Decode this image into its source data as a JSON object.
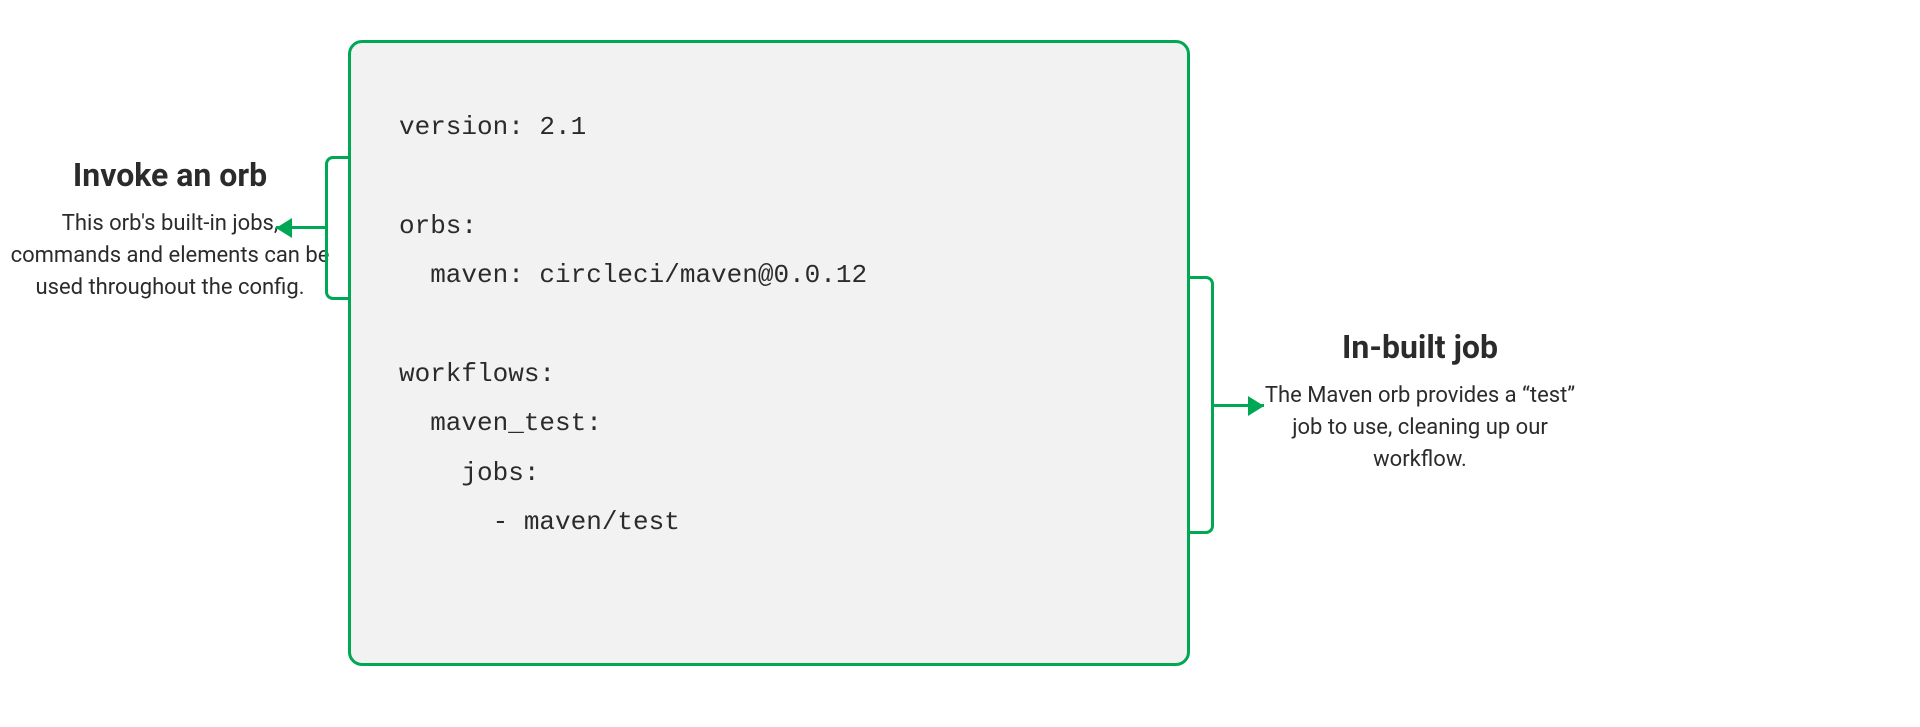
{
  "code_block": {
    "content": "version: 2.1\n\norbs:\n  maven: circleci/maven@0.0.12\n\nworkflows:\n  maven_test:\n    jobs:\n      - maven/test"
  },
  "left_annotation": {
    "title": "Invoke an orb",
    "body": "This orb's built-in jobs, commands and elements can be used throughout the config."
  },
  "right_annotation": {
    "title": "In-built job",
    "body": "The Maven orb provides a “test” job to use, cleaning up our workflow."
  },
  "colors": {
    "accent": "#00a853",
    "code_bg": "#f2f2f2",
    "text": "#2b2b2b"
  }
}
